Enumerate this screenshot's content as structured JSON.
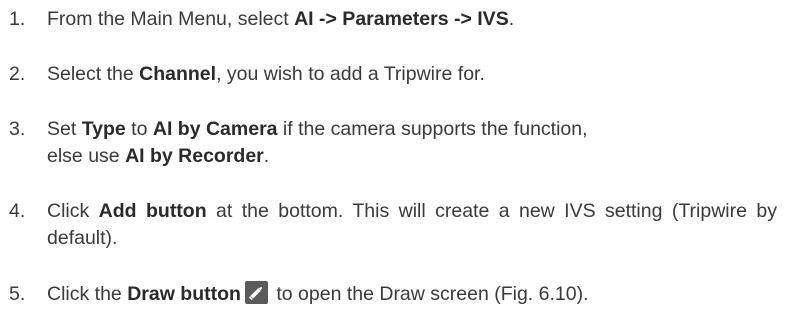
{
  "steps": [
    {
      "number": "1.",
      "parts": {
        "a": "From the Main Menu, select ",
        "b": "AI -> Parameters -> IVS",
        "c": "."
      }
    },
    {
      "number": "2.",
      "parts": {
        "a": "Select the ",
        "b": "Channel",
        "c": ", you wish to add a Tripwire for."
      }
    },
    {
      "number": "3.",
      "parts": {
        "a": "Set ",
        "b": "Type",
        "c": " to ",
        "d": "AI by Camera",
        "e": " if the camera supports the function,",
        "f": "else use ",
        "g": "AI by Recorder",
        "h": "."
      }
    },
    {
      "number": "4.",
      "parts": {
        "a": "Click ",
        "b": "Add button",
        "c": " at the bottom. This will create a new IVS setting (Tripwire by default)."
      }
    },
    {
      "number": "5.",
      "parts": {
        "a": "Click the ",
        "b": "Draw button",
        "c": " to open the Draw screen (Fig. 6.10)."
      },
      "icon": "pencil-edit-icon"
    }
  ]
}
